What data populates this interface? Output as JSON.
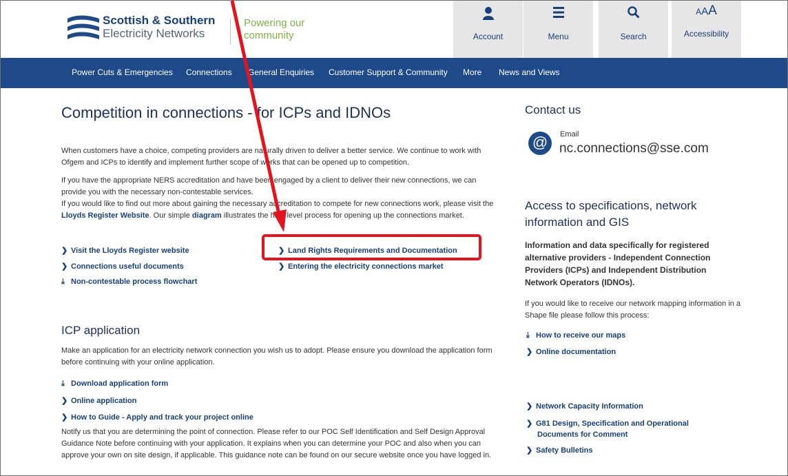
{
  "header": {
    "brand_line1": "Scottish & Southern",
    "brand_line2": "Electricity Networks",
    "tagline": "Powering our community",
    "buttons": {
      "account": "Account",
      "menu": "Menu",
      "search": "Search",
      "accessibility": "Accessibility",
      "accessibility_glyph": "AAA"
    }
  },
  "nav": {
    "items": [
      "Power Cuts & Emergencies",
      "Connections",
      "General Enquiries",
      "Customer Support & Community",
      "More",
      "News and Views"
    ]
  },
  "main": {
    "title": "Competition in connections - for ICPs and IDNOs",
    "para1": "When customers have a choice, competing providers are naturally driven to deliver a better service. We continue to work with Ofgem and ICPs to identify and implement further scope of works that can be opened up to competition.",
    "para2a": "If you have the appropriate NERS accreditation and have been engaged by a client to deliver their new connections, we can provide you with the necessary non-contestable services.",
    "para2b_pre": "If you would like to find out more about gaining the necessary accreditation to compete for new connections work, please visit the ",
    "para2b_link1": "Lloyds Register Website",
    "para2b_mid": ". Our simple ",
    "para2b_link2": "diagram",
    "para2b_post": " illustrates the high level process for opening up the connections market.",
    "links_left": [
      "Visit the Lloyds Register website",
      "Connections useful documents",
      "Non-contestable process flowchart"
    ],
    "links_right": [
      "Land Rights Requirements and Documentation",
      "Entering the electricity connections market"
    ],
    "icp_title": "ICP application",
    "icp_para": "Make an application for an electricity network connection you wish us to adopt. Please ensure you download the application form before continuing with your online application.",
    "icp_links": [
      "Download application form",
      "Online application",
      "How to Guide - Apply and track your project online"
    ],
    "notify_para": "Notify us that you are determining the point of connection. Please refer to our POC Self Identification and Self Design Approval Guidance Note before continuing with your application.  It explains when you can determine your POC and also when you can approve your own on site design, if applicable. This guidance note can be found on our secure website once you have logged in."
  },
  "sidebar": {
    "contact_title": "Contact us",
    "email_label": "Email",
    "email": "nc.connections@sse.com",
    "access_title": "Access to specifications, network information and GIS",
    "access_bold": "Information and data specifically for registered alternative providers - Independent Connection Providers (ICPs) and Independent Distribution Network Operators (IDNOs).",
    "access_para": "If you would like to receive our network mapping information in a Shape file please follow this process:",
    "links_top": [
      "How to receive our maps",
      "Online documentation"
    ],
    "links_bottom": [
      "Network Capacity Information",
      "G81 Design, Specification and Operational Documents for Comment",
      "Safety Bulletins"
    ]
  },
  "colors": {
    "nav_bg": "#1f4a8a",
    "brand_blue": "#17407a",
    "tagline_green": "#7cb342",
    "annotation_red": "#e3141d"
  }
}
